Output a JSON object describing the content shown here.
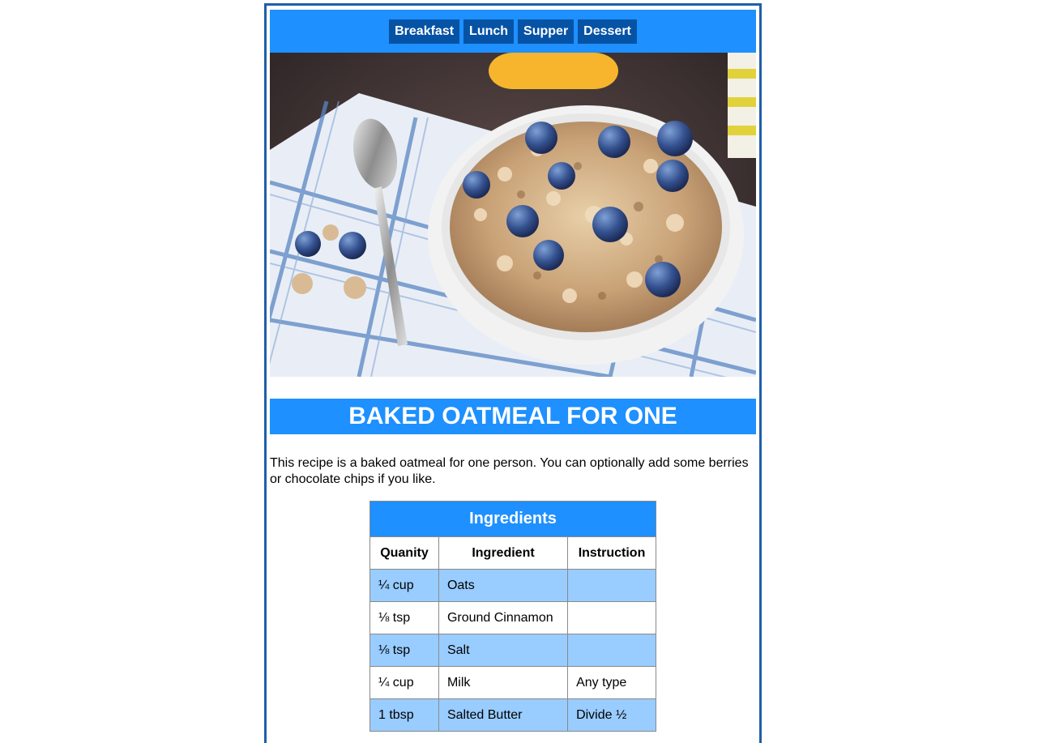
{
  "nav": {
    "items": [
      "Breakfast",
      "Lunch",
      "Supper",
      "Dessert"
    ]
  },
  "hero": {
    "alt": "Bowl of granola with blueberries, spoon on checked napkin"
  },
  "recipe": {
    "title": "BAKED OATMEAL FOR ONE",
    "intro": "This recipe is a baked oatmeal for one person. You can optionally add some berries or chocolate chips if you like."
  },
  "ingredients": {
    "caption": "Ingredients",
    "headers": [
      "Quanity",
      "Ingredient",
      "Instruction"
    ],
    "rows": [
      [
        "¼ cup",
        "Oats",
        ""
      ],
      [
        "⅛ tsp",
        "Ground Cinnamon",
        ""
      ],
      [
        "⅛ tsp",
        "Salt",
        ""
      ],
      [
        "¼ cup",
        "Milk",
        "Any type"
      ],
      [
        "1 tbsp",
        "Salted Butter",
        "Divide ½"
      ]
    ]
  },
  "colors": {
    "accent": "#1e90ff",
    "nav_button": "#0653a6",
    "frame_border": "#1f5fa8",
    "row_highlight": "#99ccff"
  }
}
